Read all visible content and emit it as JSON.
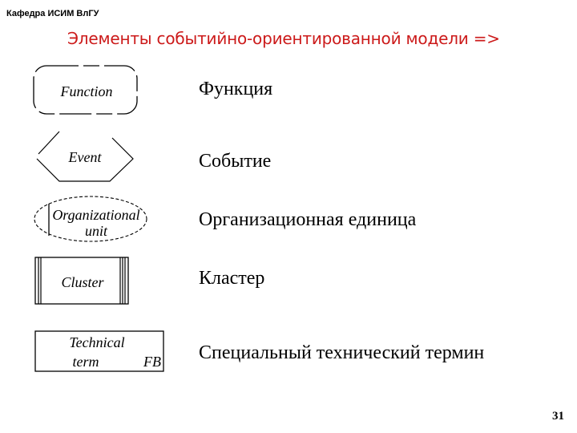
{
  "header": {
    "department": "Кафедра ИСИМ ВлГУ",
    "title": "Элементы событийно-ориентированной модели =>",
    "title_color": "#cc1a1a"
  },
  "elements": [
    {
      "shape": "rounded-rectangle",
      "shape_text": [
        "Function"
      ],
      "label": "Функция"
    },
    {
      "shape": "hexagon",
      "shape_text": [
        "Event"
      ],
      "label": "Событие"
    },
    {
      "shape": "dashed-ellipse",
      "shape_text": [
        "Organizational",
        "unit"
      ],
      "label": "Организационная единица"
    },
    {
      "shape": "triple-bordered-rectangle",
      "shape_text": [
        "Cluster"
      ],
      "label": "Кластер"
    },
    {
      "shape": "rectangle",
      "shape_text": [
        "Technical",
        "term"
      ],
      "shape_subtext": "FB",
      "label": "Специальный технический термин"
    }
  ],
  "footer": {
    "page_number": "31"
  }
}
